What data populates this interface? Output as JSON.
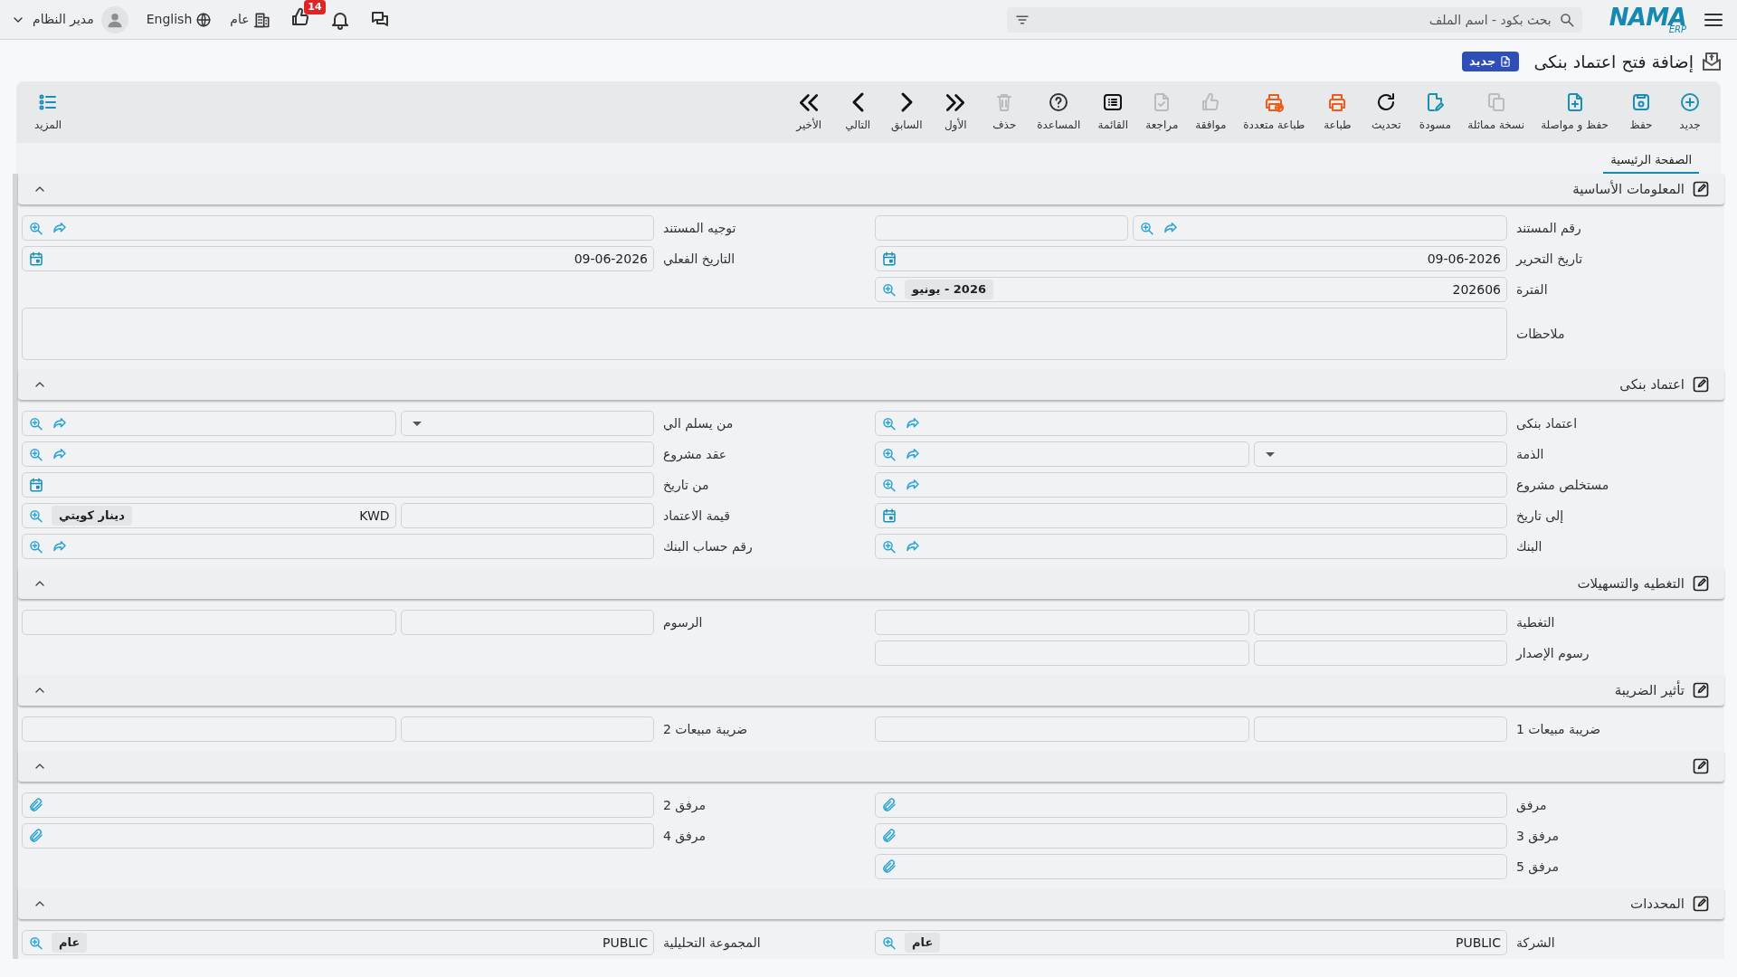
{
  "header": {
    "logo": {
      "text": "NAMA",
      "sub": "ERP"
    },
    "search": {
      "placeholder": "بحث بكود - اسم الملف"
    },
    "notifications": "14",
    "company": "عام",
    "language": "English",
    "user": "مدير النظام"
  },
  "title": {
    "text": "إضافة فتح اعتماد بنكى",
    "badge": "جديد"
  },
  "toolbar": [
    {
      "label": "جديد",
      "color": "#1a8fb5"
    },
    {
      "label": "حفظ",
      "color": "#1a8fb5"
    },
    {
      "label": "حفظ و مواصلة",
      "color": "#1a8fb5"
    },
    {
      "label": "نسخة مماثلة",
      "color": "#b8bcc2"
    },
    {
      "label": "مسودة",
      "color": "#1a8fb5"
    },
    {
      "label": "تحديث",
      "color": "#111111"
    },
    {
      "label": "طباعة",
      "color": "#f05a1a"
    },
    {
      "label": "طباعة متعددة",
      "color": "#f05a1a"
    },
    {
      "label": "موافقة",
      "color": "#b8bcc2"
    },
    {
      "label": "مراجعة",
      "color": "#b8bcc2"
    },
    {
      "label": "القائمة",
      "color": "#111111"
    },
    {
      "label": "المساعدة",
      "color": "#333333"
    },
    {
      "label": "حذف",
      "color": "#b8bcc2"
    },
    {
      "label": "الأول",
      "color": "#111111"
    },
    {
      "label": "السابق",
      "color": "#111111"
    },
    {
      "label": "التالي",
      "color": "#111111"
    },
    {
      "label": "الأخير",
      "color": "#111111"
    }
  ],
  "more": {
    "label": "المزيد"
  },
  "tabs": [
    {
      "label": "الصفحة الرئيسية",
      "selected": true
    }
  ],
  "sections": [
    {
      "title": "المعلومات الأساسية",
      "expanded": true,
      "rows": [
        [
          {
            "label": "رقم المستند",
            "parts": [
              {
                "kind": "lookup"
              },
              {
                "kind": "text"
              }
            ]
          },
          {
            "label": "توجيه المستند",
            "parts": [
              {
                "kind": "lookup"
              }
            ]
          }
        ],
        [
          {
            "label": "تاريخ التحرير",
            "parts": [
              {
                "kind": "date",
                "value": "09-06-2026"
              }
            ]
          },
          {
            "label": "التاريخ الفعلي",
            "parts": [
              {
                "kind": "date",
                "value": "09-06-2026"
              }
            ]
          }
        ],
        [
          {
            "label": "الفترة",
            "parts": [
              {
                "kind": "picker",
                "value": "202606",
                "badge": "2026 - يونيو"
              }
            ]
          }
        ],
        [
          {
            "label": "ملاحظات",
            "parts": [
              {
                "kind": "notes"
              }
            ]
          }
        ]
      ]
    },
    {
      "title": "اعتماد بنكى",
      "expanded": true,
      "rows": [
        [
          {
            "label": "اعتماد بنكى",
            "parts": [
              {
                "kind": "lookup"
              }
            ]
          },
          {
            "label": "من يسلم الي",
            "parts": [
              {
                "kind": "dropdown"
              },
              {
                "kind": "lookup"
              }
            ]
          }
        ],
        [
          {
            "label": "الذمة",
            "parts": [
              {
                "kind": "dropdown"
              },
              {
                "kind": "lookup"
              }
            ]
          },
          {
            "label": "عقد مشروع",
            "parts": [
              {
                "kind": "lookup"
              }
            ]
          }
        ],
        [
          {
            "label": "مستخلص مشروع",
            "parts": [
              {
                "kind": "lookup"
              }
            ]
          },
          {
            "label": "من تاريخ",
            "parts": [
              {
                "kind": "date"
              }
            ]
          }
        ],
        [
          {
            "label": "إلى تاريخ",
            "parts": [
              {
                "kind": "date"
              }
            ]
          },
          {
            "label": "قيمة الاعتماد",
            "parts": [
              {
                "kind": "text"
              },
              {
                "kind": "picker",
                "value": "KWD",
                "badge": "دينار كويتي"
              }
            ]
          }
        ],
        [
          {
            "label": "البنك",
            "parts": [
              {
                "kind": "lookup"
              }
            ]
          },
          {
            "label": "رقم حساب البنك",
            "parts": [
              {
                "kind": "lookup"
              }
            ]
          }
        ]
      ]
    },
    {
      "title": "التغطيه والتسهيلات",
      "expanded": true,
      "rows": [
        [
          {
            "label": "التغطية",
            "parts": [
              {
                "kind": "text"
              },
              {
                "kind": "text"
              }
            ]
          },
          {
            "label": "الرسوم",
            "parts": [
              {
                "kind": "text"
              },
              {
                "kind": "text"
              }
            ]
          }
        ],
        [
          {
            "label": "رسوم الإصدار",
            "parts": [
              {
                "kind": "text"
              },
              {
                "kind": "text"
              }
            ]
          }
        ]
      ]
    },
    {
      "title": "تأثير الضريبة",
      "expanded": true,
      "rows": [
        [
          {
            "label": "ضريبة مبيعات 1",
            "parts": [
              {
                "kind": "text"
              },
              {
                "kind": "text"
              }
            ]
          },
          {
            "label": "ضريبة مبيعات 2",
            "parts": [
              {
                "kind": "text"
              },
              {
                "kind": "text"
              }
            ]
          }
        ]
      ]
    },
    {
      "expanded": true,
      "rows": [
        [
          {
            "label": "مرفق",
            "parts": [
              {
                "kind": "attach"
              }
            ]
          },
          {
            "label": "مرفق 2",
            "parts": [
              {
                "kind": "attach"
              }
            ]
          }
        ],
        [
          {
            "label": "مرفق 3",
            "parts": [
              {
                "kind": "attach"
              }
            ]
          },
          {
            "label": "مرفق 4",
            "parts": [
              {
                "kind": "attach"
              }
            ]
          }
        ],
        [
          {
            "label": "مرفق 5",
            "parts": [
              {
                "kind": "attach"
              }
            ]
          }
        ]
      ]
    },
    {
      "title": "المحددات",
      "expanded": true,
      "rows": [
        [
          {
            "label": "الشركة",
            "parts": [
              {
                "kind": "picker",
                "value": "PUBLIC",
                "badge": "عام"
              }
            ]
          },
          {
            "label": "المجموعة التحليلية",
            "parts": [
              {
                "kind": "picker",
                "value": "PUBLIC",
                "badge": "عام"
              }
            ]
          }
        ]
      ]
    }
  ]
}
